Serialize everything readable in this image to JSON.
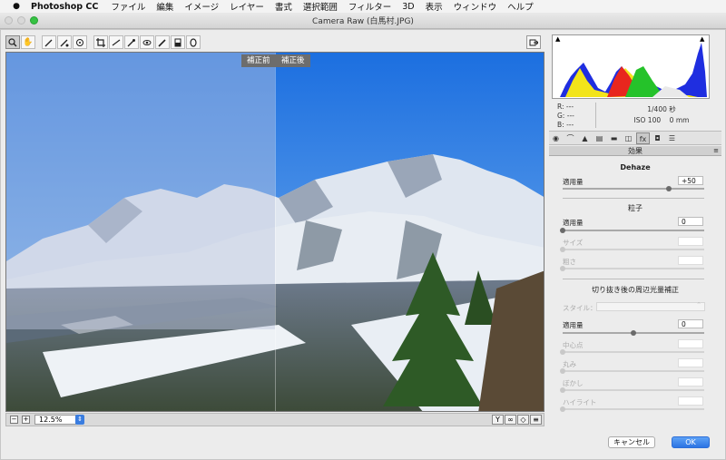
{
  "menubar": {
    "app_name": "Photoshop CC",
    "items": [
      "ファイル",
      "編集",
      "イメージ",
      "レイヤー",
      "書式",
      "選択範囲",
      "フィルター",
      "3D",
      "表示",
      "ウィンドウ",
      "ヘルプ"
    ]
  },
  "window": {
    "title": "Camera Raw (白馬村.JPG)"
  },
  "toolbar": {
    "tools": [
      "zoom-icon",
      "hand-icon",
      "eyedropper-icon",
      "color-sampler-icon",
      "target-adjust-icon",
      "crop-icon",
      "straighten-icon",
      "spot-removal-icon",
      "red-eye-icon",
      "adjustment-brush-icon",
      "graduated-filter-icon",
      "radial-filter-icon"
    ]
  },
  "preview": {
    "before_label": "補正前",
    "after_label": "補正後",
    "zoom_value": "12.5%"
  },
  "info": {
    "r_label": "R:",
    "r_value": "---",
    "g_label": "G:",
    "g_value": "---",
    "b_label": "B:",
    "b_value": "---",
    "shutter": "1/400 秒",
    "iso_focal": "ISO 100    0 mm"
  },
  "panel": {
    "section_title": "効果",
    "dehaze": {
      "title": "Dehaze",
      "amount_label": "適用量",
      "amount_value": "+50",
      "level": 0.75
    },
    "grain": {
      "title": "粒子",
      "amount_label": "適用量",
      "amount_value": "0",
      "amount_level": 0.0,
      "size_label": "サイズ",
      "roughness_label": "粗さ"
    },
    "vignette": {
      "title": "切り抜き後の周辺光量補正",
      "style_label": "スタイル：",
      "amount_label": "適用量",
      "amount_value": "0",
      "amount_level": 0.5,
      "midpoint_label": "中心点",
      "roundness_label": "丸み",
      "feather_label": "ぼかし",
      "highlights_label": "ハイライト"
    }
  },
  "buttons": {
    "cancel": "キャンセル",
    "ok": "OK"
  },
  "colors": {
    "accent": "#2b74e3",
    "sky": "#2f84e8",
    "grass": "#2e5a26"
  }
}
